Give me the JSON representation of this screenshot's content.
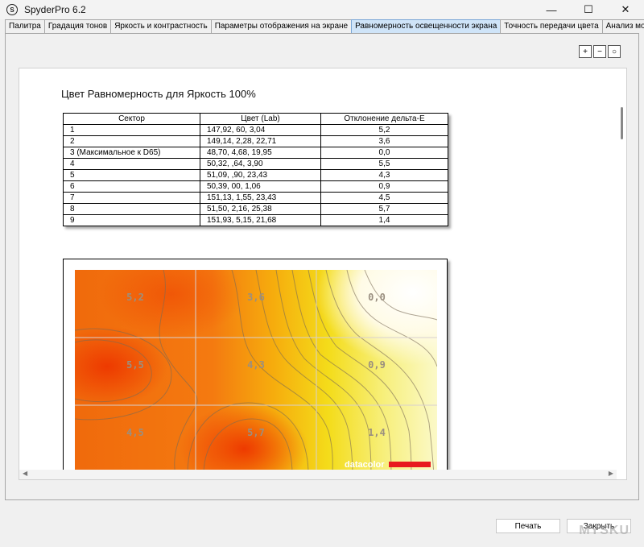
{
  "window": {
    "title": "SpyderPro 6.2",
    "controls": [
      "—",
      "☐",
      "✕"
    ]
  },
  "tabs": [
    {
      "label": "Палитра"
    },
    {
      "label": "Градация тонов"
    },
    {
      "label": "Яркость и контрастность"
    },
    {
      "label": "Параметры отображения на экране"
    },
    {
      "label": "Равномерность освещенности экрана",
      "active": true
    },
    {
      "label": "Точность передачи цвета"
    },
    {
      "label": "Анализ монитора"
    }
  ],
  "zoom": {
    "zoom_in": "+",
    "zoom_out": "−",
    "zoom_fit": "○"
  },
  "report": {
    "title": "Цвет Равномерность для Яркость 100%",
    "table": {
      "headers": [
        "Сектор",
        "Цвет (Lab)",
        "Отклонение дельта-E"
      ],
      "rows": [
        [
          "1",
          "147,92,    60,   3,04",
          "5,2"
        ],
        [
          "2",
          "149,14,   2,28,  22,71",
          "3,6"
        ],
        [
          "3 (Максимальное к D65)",
          "48,70,  4,68, 19,95",
          "0,0"
        ],
        [
          "4",
          "50,32,    ,64,   3,90",
          "5,5"
        ],
        [
          "5",
          "51,09,    ,90,  23,43",
          "4,3"
        ],
        [
          "6",
          "50,39,    00,   1,06",
          "0,9"
        ],
        [
          "7",
          "151,13,   1,55,  23,43",
          "4,5"
        ],
        [
          "8",
          "51,50,  2,16, 25,38",
          "5,7"
        ],
        [
          "9",
          "151,93,  5,15,  21,68",
          "1,4"
        ]
      ]
    },
    "heatmap": {
      "cell_labels": [
        "5,2",
        "3,6",
        "0,0",
        "5,5",
        "4,3",
        "0,9",
        "4,5",
        "5,7",
        "1,4"
      ],
      "brand": "datacolor",
      "colors": {
        "hot": "#ee3a00",
        "mid": "#f6d200",
        "cold": "#ffffff",
        "brand_bar": "#e8191f"
      }
    }
  },
  "footer": {
    "print_label": "Печать",
    "close_label": "Закрыть"
  },
  "watermark": "MYSKU"
}
